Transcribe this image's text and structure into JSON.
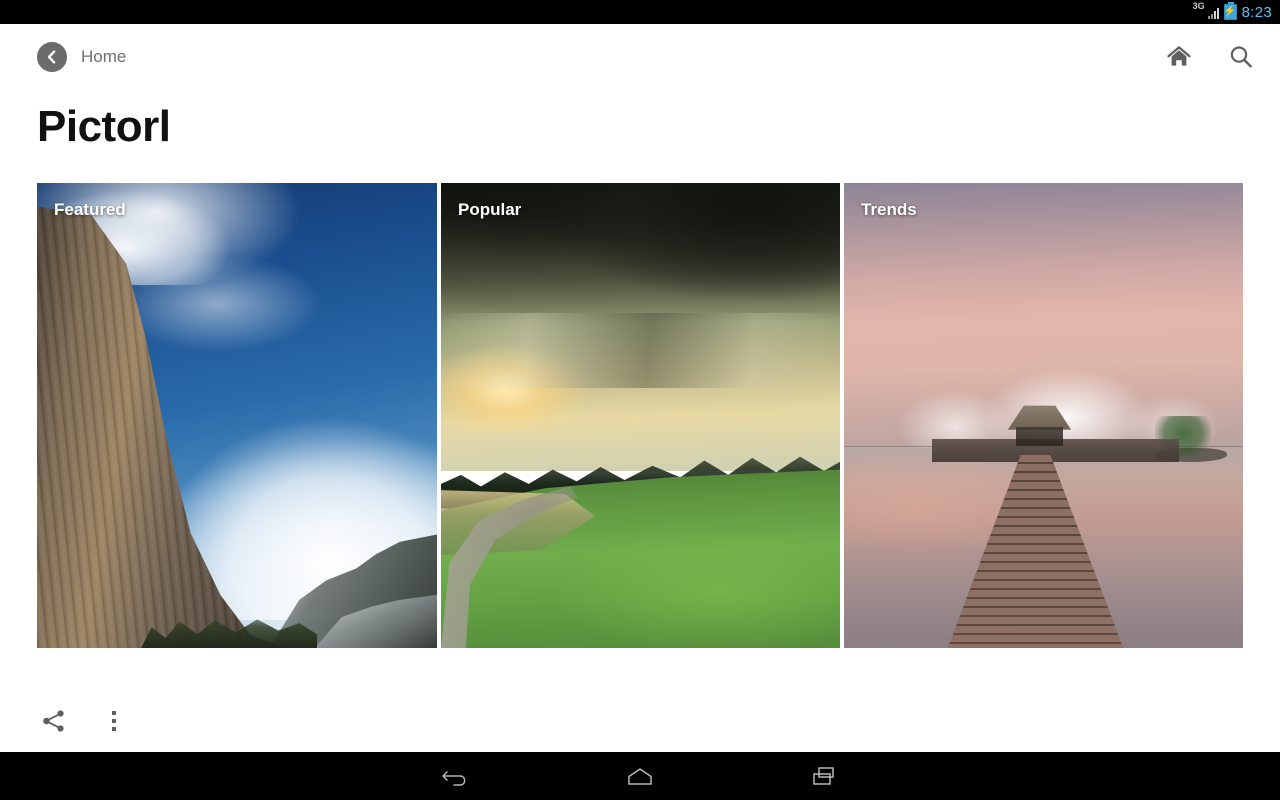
{
  "status_bar": {
    "network_type": "3G",
    "time": "8:23",
    "time_color": "#4fc3f7",
    "battery_state": "charging",
    "signal_bars": 4,
    "background": "#000000"
  },
  "action_bar": {
    "back_icon": "back-chevron-icon",
    "up_label": "Home",
    "actions": [
      {
        "name": "home",
        "icon": "home-icon"
      },
      {
        "name": "search",
        "icon": "search-icon"
      }
    ]
  },
  "page": {
    "title": "Pictorl"
  },
  "cards": [
    {
      "label": "Featured",
      "image": "cliff-blue-sky-photo"
    },
    {
      "label": "Popular",
      "image": "golf-course-sunset-photo"
    },
    {
      "label": "Trends",
      "image": "tropical-pier-sunset-photo"
    }
  ],
  "bottom_toolbar": {
    "actions": [
      {
        "name": "share",
        "icon": "share-icon"
      },
      {
        "name": "overflow",
        "icon": "overflow-menu-icon"
      }
    ]
  },
  "navigation_bar": {
    "buttons": [
      {
        "name": "back",
        "icon": "nav-back-icon"
      },
      {
        "name": "home",
        "icon": "nav-home-icon"
      },
      {
        "name": "recents",
        "icon": "nav-recents-icon"
      }
    ],
    "background": "#000000"
  }
}
